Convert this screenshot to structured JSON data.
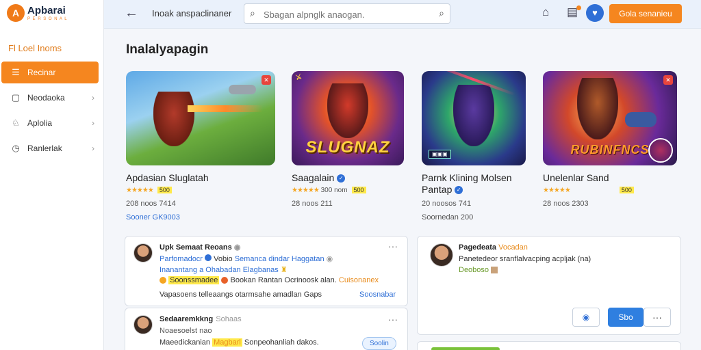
{
  "brand": {
    "name": "Apbarai",
    "sub": "P E R S O N A L",
    "logo_letter": "A",
    "accent": "#f5861f"
  },
  "sidebar": {
    "section_label": "Fl Loel Inoms",
    "items": [
      {
        "label": "Recinar",
        "icon": "menu-icon",
        "glyph": "☰"
      },
      {
        "label": "Neodaoka",
        "icon": "bookmark-icon",
        "glyph": "▢"
      },
      {
        "label": "Aplolia",
        "icon": "thumbs-up-icon",
        "glyph": "♘"
      },
      {
        "label": "Ranlerlak",
        "icon": "clock-icon",
        "glyph": "◷"
      }
    ]
  },
  "topbar": {
    "crumb": "Inoak anspaclinaner",
    "search_placeholder": "Sbagan alpnglk anaogan.",
    "cta_label": "Gola senanieu"
  },
  "main": {
    "title": "Inalalyapagin",
    "games": [
      {
        "title": "Apdasian Sluglatah",
        "rating_text": "",
        "pill": "500",
        "meta": "208 noos 7414",
        "link": "Sooner GK9003",
        "overlay": "",
        "verified": false
      },
      {
        "title": "Saagalain",
        "rating_text": "300 nom",
        "pill": "500",
        "meta": "28 noos 211",
        "link": "",
        "overlay": "SLUGNAZ",
        "verified": true
      },
      {
        "title": "Parnk Klining Molsen Pantap",
        "rating_text": "",
        "pill": "",
        "meta": "20 noosos 741",
        "link": "Soornedan 200",
        "overlay": "",
        "verified": true
      },
      {
        "title": "Unelenlar Sand",
        "rating_text": "",
        "pill": "500",
        "meta": "28 noos 2303",
        "link": "",
        "overlay": "RUBINFNCS",
        "verified": false
      }
    ]
  },
  "feed": {
    "post1": {
      "name": "Upk Semaat Reoans",
      "line1_a": "Parfomadocr",
      "line1_b": "Vobio",
      "line1_c": "Semanca dindar",
      "line1_d": "Haggatan",
      "line2_a": "Inanantang a",
      "line2_b": "Ohabadan",
      "line2_c": "Elagbanas",
      "line3_a": "Soonssmadee",
      "line3_b": "Bookan Rantan",
      "line3_c": "Ocrinoosk alan.",
      "line3_d": "Cuisonanex",
      "line4": "Vapasoens telleaangs otarmsahe amadlan Gaps",
      "line4_link": "Soosnabar"
    },
    "post2": {
      "name": "Pagedeata",
      "name_tag": "Vocadan",
      "line1": "Panetedeor sranflalvacping acpljak (na)",
      "line2": "Deoboso",
      "btn_primary": "Sbo",
      "btn_more": "···"
    },
    "post3": {
      "name": "Sedaaremkkng",
      "sub": "Sohaas",
      "line1_a": "Noaesoelst nao",
      "line2_a": "Maeedickanian",
      "line2_b": "Magbarl",
      "line2_c": "Sonpeohanliah dakos.",
      "chip": "Soolin"
    }
  }
}
